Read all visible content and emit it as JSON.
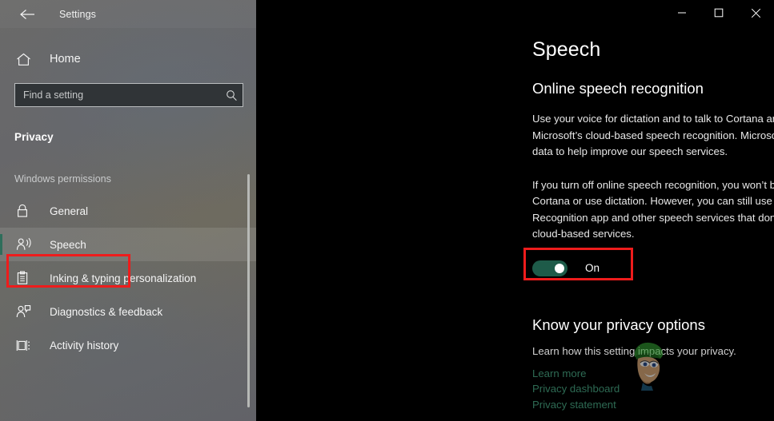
{
  "window": {
    "title": "Settings",
    "back_icon": "back-arrow-icon",
    "controls": [
      {
        "name": "minimize-button",
        "glyph": "—"
      },
      {
        "name": "maximize-button",
        "glyph": "□"
      },
      {
        "name": "close-button",
        "glyph": "✕"
      }
    ]
  },
  "sidebar": {
    "home_label": "Home",
    "home_icon": "home-icon",
    "search": {
      "placeholder": "Find a setting",
      "value": "",
      "icon": "search-icon"
    },
    "section_title": "Privacy",
    "group_header": "Windows permissions",
    "items": [
      {
        "label": "General",
        "icon": "lock-icon",
        "selected": false
      },
      {
        "label": "Speech",
        "icon": "speech-person-icon",
        "selected": true
      },
      {
        "label": "Inking & typing personalization",
        "icon": "clipboard-icon",
        "selected": false
      },
      {
        "label": "Diagnostics & feedback",
        "icon": "person-feedback-icon",
        "selected": false
      },
      {
        "label": "Activity history",
        "icon": "timeline-icon",
        "selected": false
      }
    ]
  },
  "main": {
    "page_heading": "Speech",
    "subsection_heading": "Online speech recognition",
    "paragraph_1": "Use your voice for dictation and to talk to Cortana and other apps that use Microsoft’s cloud-based speech recognition. Microsoft will use your voice data to help improve our speech services.",
    "paragraph_2": "If you turn off online speech recognition, you won’t be able to speak to Cortana or use dictation. However, you can still use the Windows Speech Recognition app and other speech services that don’t rely on Microsoft’s cloud-based services.",
    "toggle": {
      "state_label": "On",
      "checked": true,
      "on_color": "#1e5b49"
    },
    "privacy": {
      "heading": "Know your privacy options",
      "subtitle": "Learn how this setting impacts your privacy.",
      "links": [
        "Learn more",
        "Privacy dashboard",
        "Privacy statement"
      ],
      "link_color": "#2e6b54"
    }
  },
  "annotations": {
    "color": "#ee1c1c",
    "boxes": [
      {
        "name": "sidebar-speech-highlight"
      },
      {
        "name": "toggle-highlight"
      }
    ]
  },
  "watermark": {
    "name": "cartoon-mascot-watermark"
  }
}
